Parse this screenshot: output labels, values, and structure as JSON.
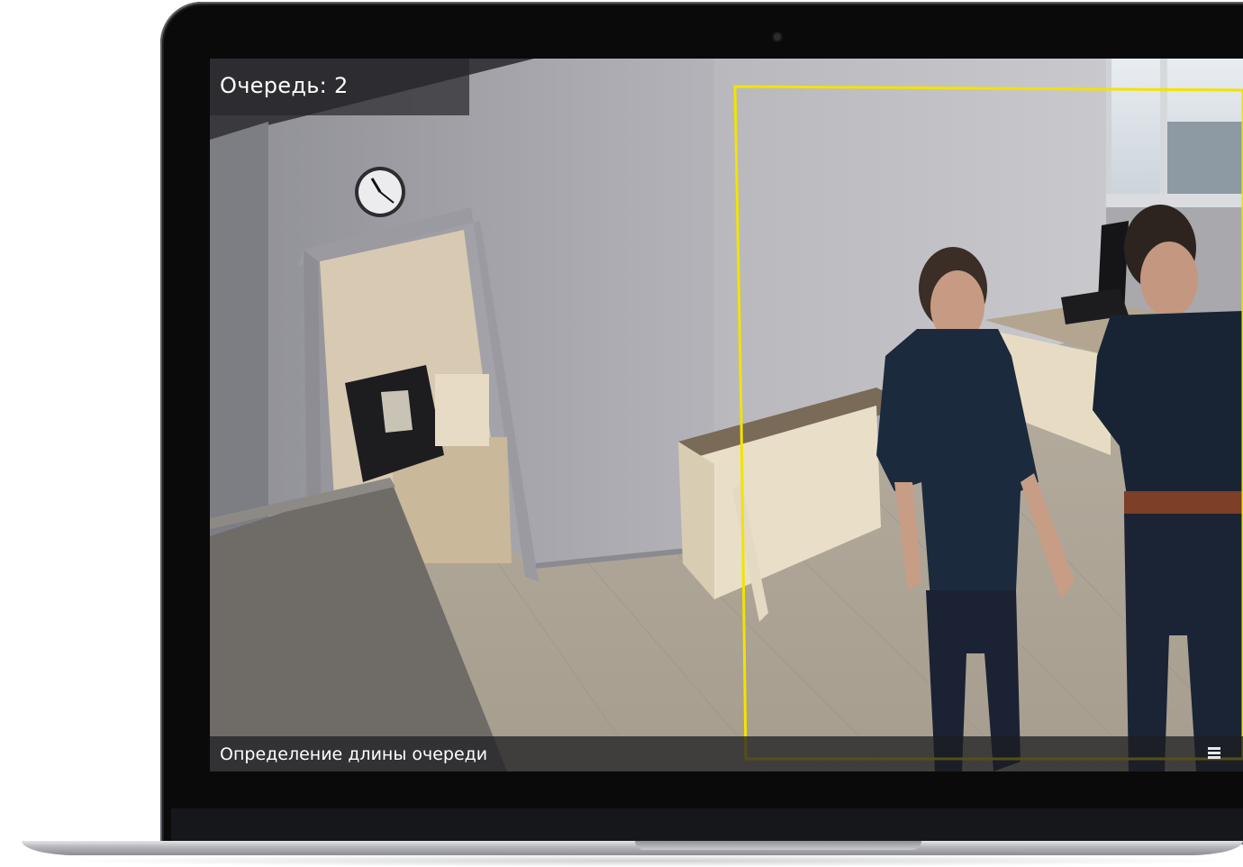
{
  "video": {
    "queue_label": "Очередь: 2",
    "caption": "Определение длины очереди",
    "detection_zone_color": "#f2e300",
    "menu_icon": "menu-icon"
  }
}
